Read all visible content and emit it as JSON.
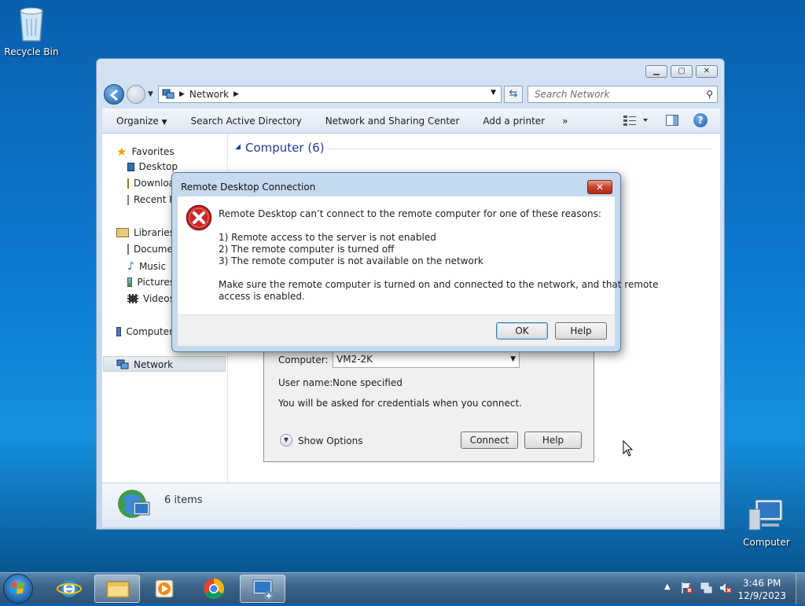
{
  "desktop": {
    "recycle_bin_label": "Recycle Bin",
    "computer_label": "Computer"
  },
  "explorer": {
    "address_path": "Network",
    "search_placeholder": "Search Network",
    "toolbar": {
      "organize": "Organize",
      "search_ad": "Search Active Directory",
      "network_sharing": "Network and Sharing Center",
      "add_printer": "Add a printer",
      "more": "»"
    },
    "nav": {
      "favorites": "Favorites",
      "desktop": "Desktop",
      "downloads": "Downloads",
      "recent": "Recent Places",
      "libraries": "Libraries",
      "documents": "Documents",
      "music": "Music",
      "pictures": "Pictures",
      "videos": "Videos",
      "computer": "Computer",
      "network": "Network"
    },
    "group_header": "Computer (6)",
    "status_items": "6 items"
  },
  "rdc_window": {
    "computer_label": "Computer:",
    "computer_value": "VM2-2K",
    "username_label": "User name:",
    "username_value": "None specified",
    "credentials_note": "You will be asked for credentials when you connect.",
    "show_options": "Show Options",
    "connect": "Connect",
    "help": "Help"
  },
  "error_dialog": {
    "title": "Remote Desktop Connection",
    "message": "Remote Desktop can’t connect to the remote computer for one of these reasons:",
    "reasons": [
      "1) Remote access to the server is not enabled",
      "2) The remote computer is turned off",
      "3) The remote computer is not available on the network"
    ],
    "advice_line1": "Make sure the remote computer is turned on and connected to the network, and that remote",
    "advice_line2": "access is enabled.",
    "ok": "OK",
    "help": "Help"
  },
  "taskbar": {
    "time": "3:46 PM",
    "date": "12/9/2023"
  },
  "colors": {
    "desktop_blue": "#0c7ad0",
    "error_red": "#c62828",
    "taskbar": "#3a6288"
  }
}
